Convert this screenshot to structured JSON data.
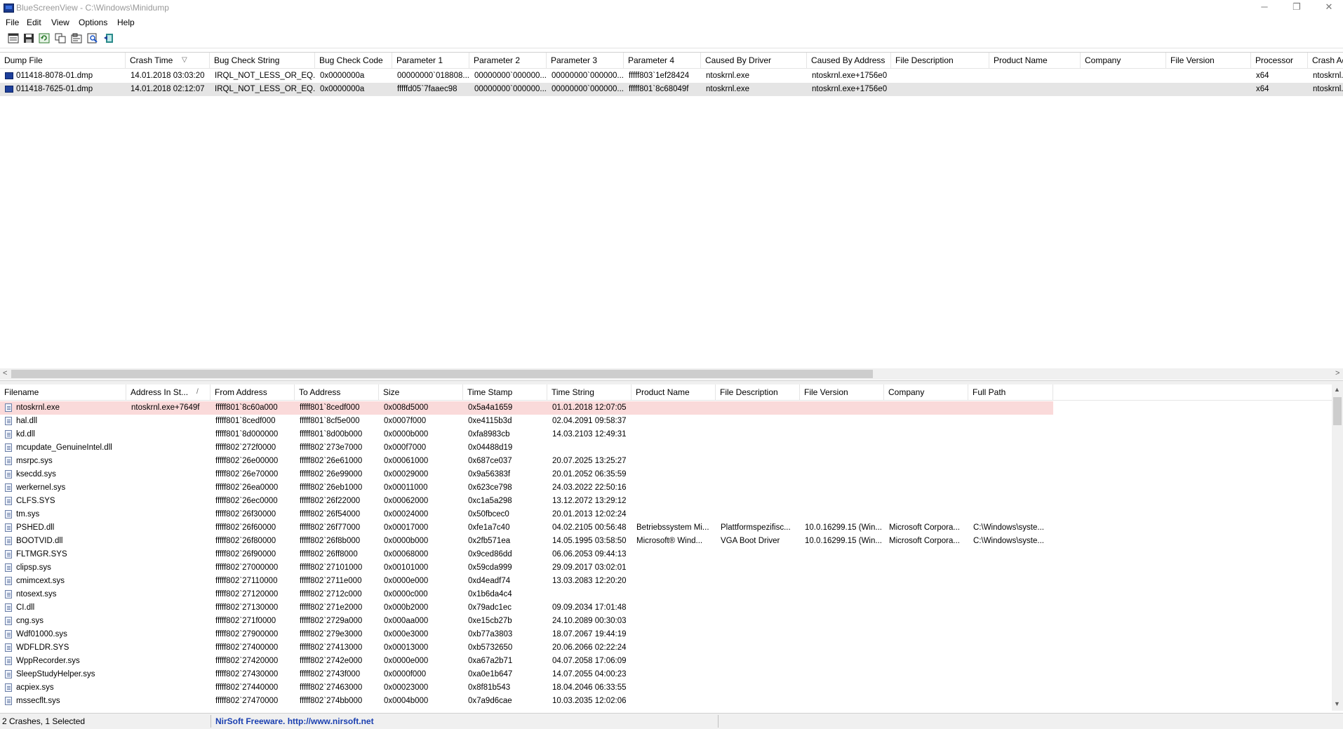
{
  "window": {
    "title": "BlueScreenView  -  C:\\Windows\\Minidump",
    "minimize": "─",
    "restore": "❐",
    "close": "✕"
  },
  "menu": [
    "File",
    "Edit",
    "View",
    "Options",
    "Help"
  ],
  "toolbar": [
    "properties-icon",
    "save-icon",
    "refresh-icon",
    "copy-icon",
    "advanced-options-icon",
    "find-icon",
    "exit-icon"
  ],
  "upper": {
    "columns": [
      "Dump File",
      "Crash Time",
      "Bug Check String",
      "Bug Check Code",
      "Parameter 1",
      "Parameter 2",
      "Parameter 3",
      "Parameter 4",
      "Caused By Driver",
      "Caused By Address",
      "File Description",
      "Product Name",
      "Company",
      "File Version",
      "Processor",
      "Crash Ad"
    ],
    "sort_indicator": "▽",
    "rows": [
      [
        "011418-8078-01.dmp",
        "14.01.2018 03:03:20",
        "IRQL_NOT_LESS_OR_EQ...",
        "0x0000000a",
        "00000000`018808...",
        "00000000`000000...",
        "00000000`000000...",
        "fffff803`1ef28424",
        "ntoskrnl.exe",
        "ntoskrnl.exe+1756e0",
        "",
        "",
        "",
        "",
        "x64",
        "ntoskrnl."
      ],
      [
        "011418-7625-01.dmp",
        "14.01.2018 02:12:07",
        "IRQL_NOT_LESS_OR_EQ...",
        "0x0000000a",
        "fffffd05`7faaec98",
        "00000000`000000...",
        "00000000`000000...",
        "fffff801`8c68049f",
        "ntoskrnl.exe",
        "ntoskrnl.exe+1756e0",
        "",
        "",
        "",
        "",
        "x64",
        "ntoskrnl."
      ]
    ]
  },
  "lower": {
    "columns": [
      "Filename",
      "Address In St...",
      "From Address",
      "To Address",
      "Size",
      "Time Stamp",
      "Time String",
      "Product Name",
      "File Description",
      "File Version",
      "Company",
      "Full Path"
    ],
    "sort_indicator": "/",
    "rows": [
      [
        "ntoskrnl.exe",
        "ntoskrnl.exe+7649f",
        "fffff801`8c60a000",
        "fffff801`8cedf000",
        "0x008d5000",
        "0x5a4a1659",
        "01.01.2018 12:07:05",
        "",
        "",
        "",
        "",
        ""
      ],
      [
        "hal.dll",
        "",
        "fffff801`8cedf000",
        "fffff801`8cf5e000",
        "0x0007f000",
        "0xe4115b3d",
        "02.04.2091 09:58:37",
        "",
        "",
        "",
        "",
        ""
      ],
      [
        "kd.dll",
        "",
        "fffff801`8d000000",
        "fffff801`8d00b000",
        "0x0000b000",
        "0xfa8983cb",
        "14.03.2103 12:49:31",
        "",
        "",
        "",
        "",
        ""
      ],
      [
        "mcupdate_GenuineIntel.dll",
        "",
        "fffff802`272f0000",
        "fffff802`273e7000",
        "0x000f7000",
        "0x04488d19",
        "",
        "",
        "",
        "",
        "",
        ""
      ],
      [
        "msrpc.sys",
        "",
        "fffff802`26e00000",
        "fffff802`26e61000",
        "0x00061000",
        "0x687ce037",
        "20.07.2025 13:25:27",
        "",
        "",
        "",
        "",
        ""
      ],
      [
        "ksecdd.sys",
        "",
        "fffff802`26e70000",
        "fffff802`26e99000",
        "0x00029000",
        "0x9a56383f",
        "20.01.2052 06:35:59",
        "",
        "",
        "",
        "",
        ""
      ],
      [
        "werkernel.sys",
        "",
        "fffff802`26ea0000",
        "fffff802`26eb1000",
        "0x00011000",
        "0x623ce798",
        "24.03.2022 22:50:16",
        "",
        "",
        "",
        "",
        ""
      ],
      [
        "CLFS.SYS",
        "",
        "fffff802`26ec0000",
        "fffff802`26f22000",
        "0x00062000",
        "0xc1a5a298",
        "13.12.2072 13:29:12",
        "",
        "",
        "",
        "",
        ""
      ],
      [
        "tm.sys",
        "",
        "fffff802`26f30000",
        "fffff802`26f54000",
        "0x00024000",
        "0x50fbcec0",
        "20.01.2013 12:02:24",
        "",
        "",
        "",
        "",
        ""
      ],
      [
        "PSHED.dll",
        "",
        "fffff802`26f60000",
        "fffff802`26f77000",
        "0x00017000",
        "0xfe1a7c40",
        "04.02.2105 00:56:48",
        "Betriebssystem Mi...",
        "Plattformspezifisc...",
        "10.0.16299.15 (Win...",
        "Microsoft Corpora...",
        "C:\\Windows\\syste..."
      ],
      [
        "BOOTVID.dll",
        "",
        "fffff802`26f80000",
        "fffff802`26f8b000",
        "0x0000b000",
        "0x2fb571ea",
        "14.05.1995 03:58:50",
        "Microsoft® Wind...",
        "VGA Boot Driver",
        "10.0.16299.15 (Win...",
        "Microsoft Corpora...",
        "C:\\Windows\\syste..."
      ],
      [
        "FLTMGR.SYS",
        "",
        "fffff802`26f90000",
        "fffff802`26ff8000",
        "0x00068000",
        "0x9ced86dd",
        "06.06.2053 09:44:13",
        "",
        "",
        "",
        "",
        ""
      ],
      [
        "clipsp.sys",
        "",
        "fffff802`27000000",
        "fffff802`27101000",
        "0x00101000",
        "0x59cda999",
        "29.09.2017 03:02:01",
        "",
        "",
        "",
        "",
        ""
      ],
      [
        "cmimcext.sys",
        "",
        "fffff802`27110000",
        "fffff802`2711e000",
        "0x0000e000",
        "0xd4eadf74",
        "13.03.2083 12:20:20",
        "",
        "",
        "",
        "",
        ""
      ],
      [
        "ntosext.sys",
        "",
        "fffff802`27120000",
        "fffff802`2712c000",
        "0x0000c000",
        "0x1b6da4c4",
        "",
        "",
        "",
        "",
        "",
        ""
      ],
      [
        "CI.dll",
        "",
        "fffff802`27130000",
        "fffff802`271e2000",
        "0x000b2000",
        "0x79adc1ec",
        "09.09.2034 17:01:48",
        "",
        "",
        "",
        "",
        ""
      ],
      [
        "cng.sys",
        "",
        "fffff802`271f0000",
        "fffff802`2729a000",
        "0x000aa000",
        "0xe15cb27b",
        "24.10.2089 00:30:03",
        "",
        "",
        "",
        "",
        ""
      ],
      [
        "Wdf01000.sys",
        "",
        "fffff802`27900000",
        "fffff802`279e3000",
        "0x000e3000",
        "0xb77a3803",
        "18.07.2067 19:44:19",
        "",
        "",
        "",
        "",
        ""
      ],
      [
        "WDFLDR.SYS",
        "",
        "fffff802`27400000",
        "fffff802`27413000",
        "0x00013000",
        "0xb5732650",
        "20.06.2066 02:22:24",
        "",
        "",
        "",
        "",
        ""
      ],
      [
        "WppRecorder.sys",
        "",
        "fffff802`27420000",
        "fffff802`2742e000",
        "0x0000e000",
        "0xa67a2b71",
        "04.07.2058 17:06:09",
        "",
        "",
        "",
        "",
        ""
      ],
      [
        "SleepStudyHelper.sys",
        "",
        "fffff802`27430000",
        "fffff802`2743f000",
        "0x0000f000",
        "0xa0e1b647",
        "14.07.2055 04:00:23",
        "",
        "",
        "",
        "",
        ""
      ],
      [
        "acpiex.sys",
        "",
        "fffff802`27440000",
        "fffff802`27463000",
        "0x00023000",
        "0x8f81b543",
        "18.04.2046 06:33:55",
        "",
        "",
        "",
        "",
        ""
      ],
      [
        "mssecflt.sys",
        "",
        "fffff802`27470000",
        "fffff802`274bb000",
        "0x0004b000",
        "0x7a9d6cae",
        "10.03.2035 12:02:06",
        "",
        "",
        "",
        "",
        ""
      ]
    ]
  },
  "status": {
    "left": "2 Crashes, 1 Selected",
    "link": "NirSoft Freeware.  http://www.nirsoft.net"
  },
  "colors": {
    "selected_row": "#e5e5e5",
    "highlight_row": "#fadada",
    "link": "#1a3fb0"
  }
}
